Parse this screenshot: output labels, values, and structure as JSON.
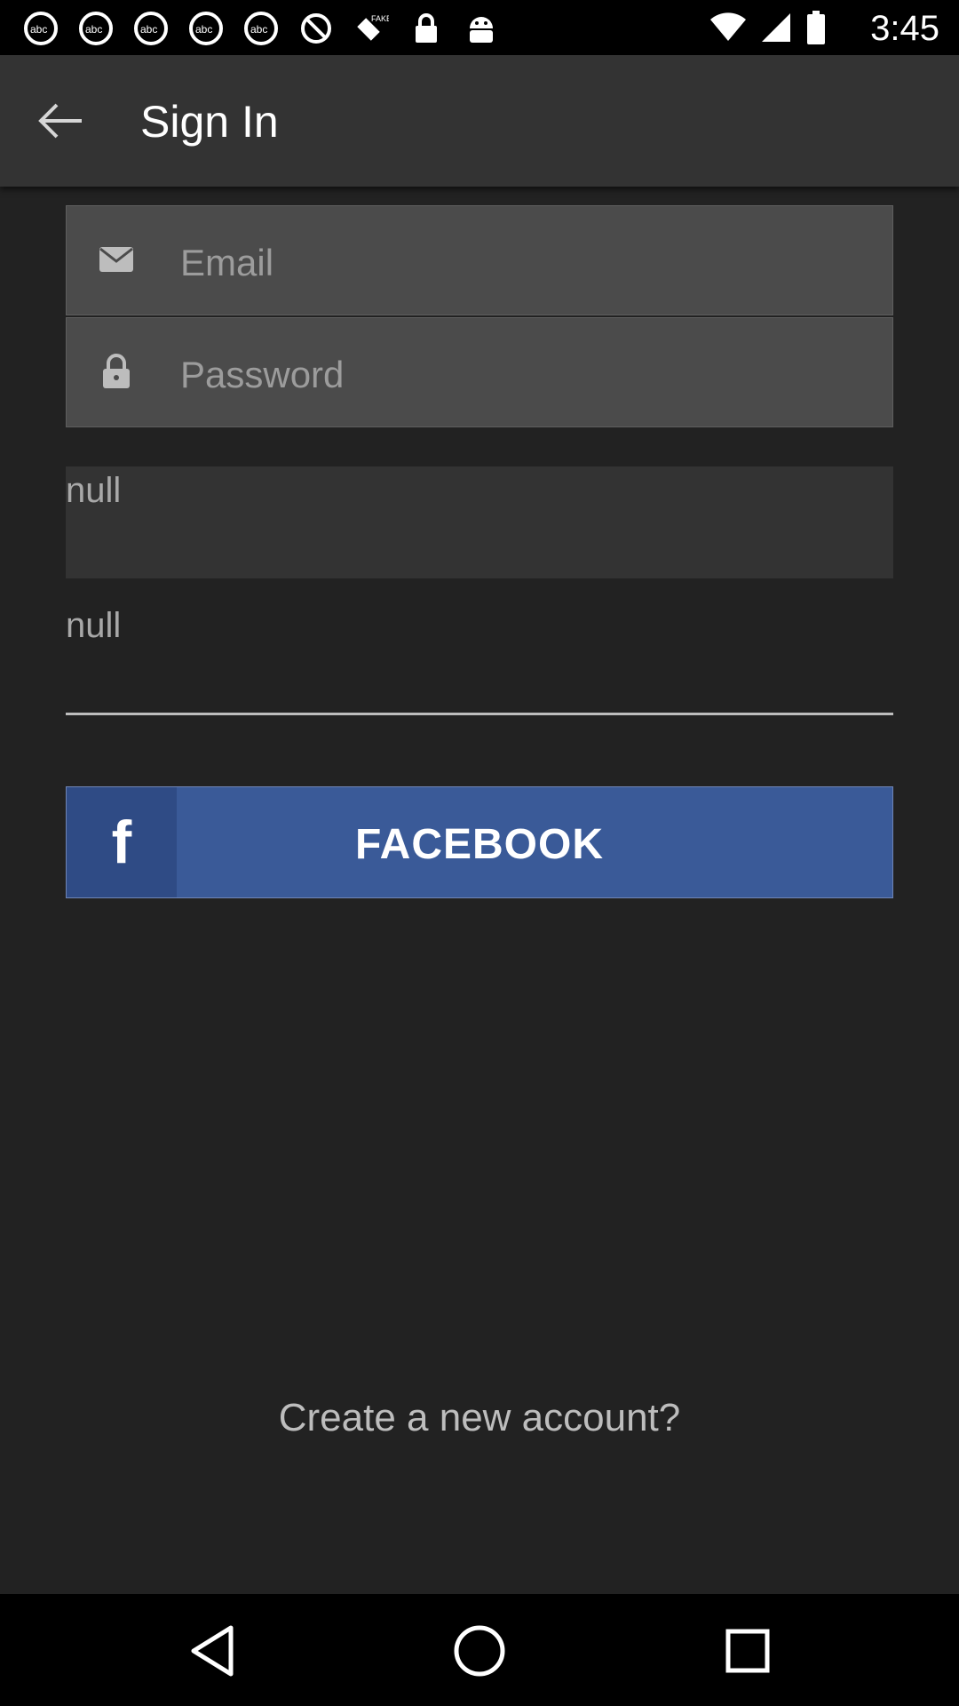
{
  "status_bar": {
    "time": "3:45",
    "notification_icons": [
      "abc7-news-icon",
      "abc7-news-icon",
      "abc7-news-icon",
      "abc7-news-icon",
      "abc7-news-icon",
      "no-entry-icon",
      "fake-gps-icon",
      "lock-icon",
      "android-icon"
    ],
    "fake_label": "FAKE"
  },
  "app_bar": {
    "title": "Sign In"
  },
  "form": {
    "email_placeholder": "Email",
    "password_placeholder": "Password",
    "field1_value": "null",
    "field2_value": "null",
    "facebook_label": "FACEBOOK",
    "facebook_letter": "f"
  },
  "footer": {
    "create_account": "Create a new account?"
  },
  "colors": {
    "background": "#222222",
    "appbar": "#333333",
    "facebook": "#3a5a98"
  }
}
